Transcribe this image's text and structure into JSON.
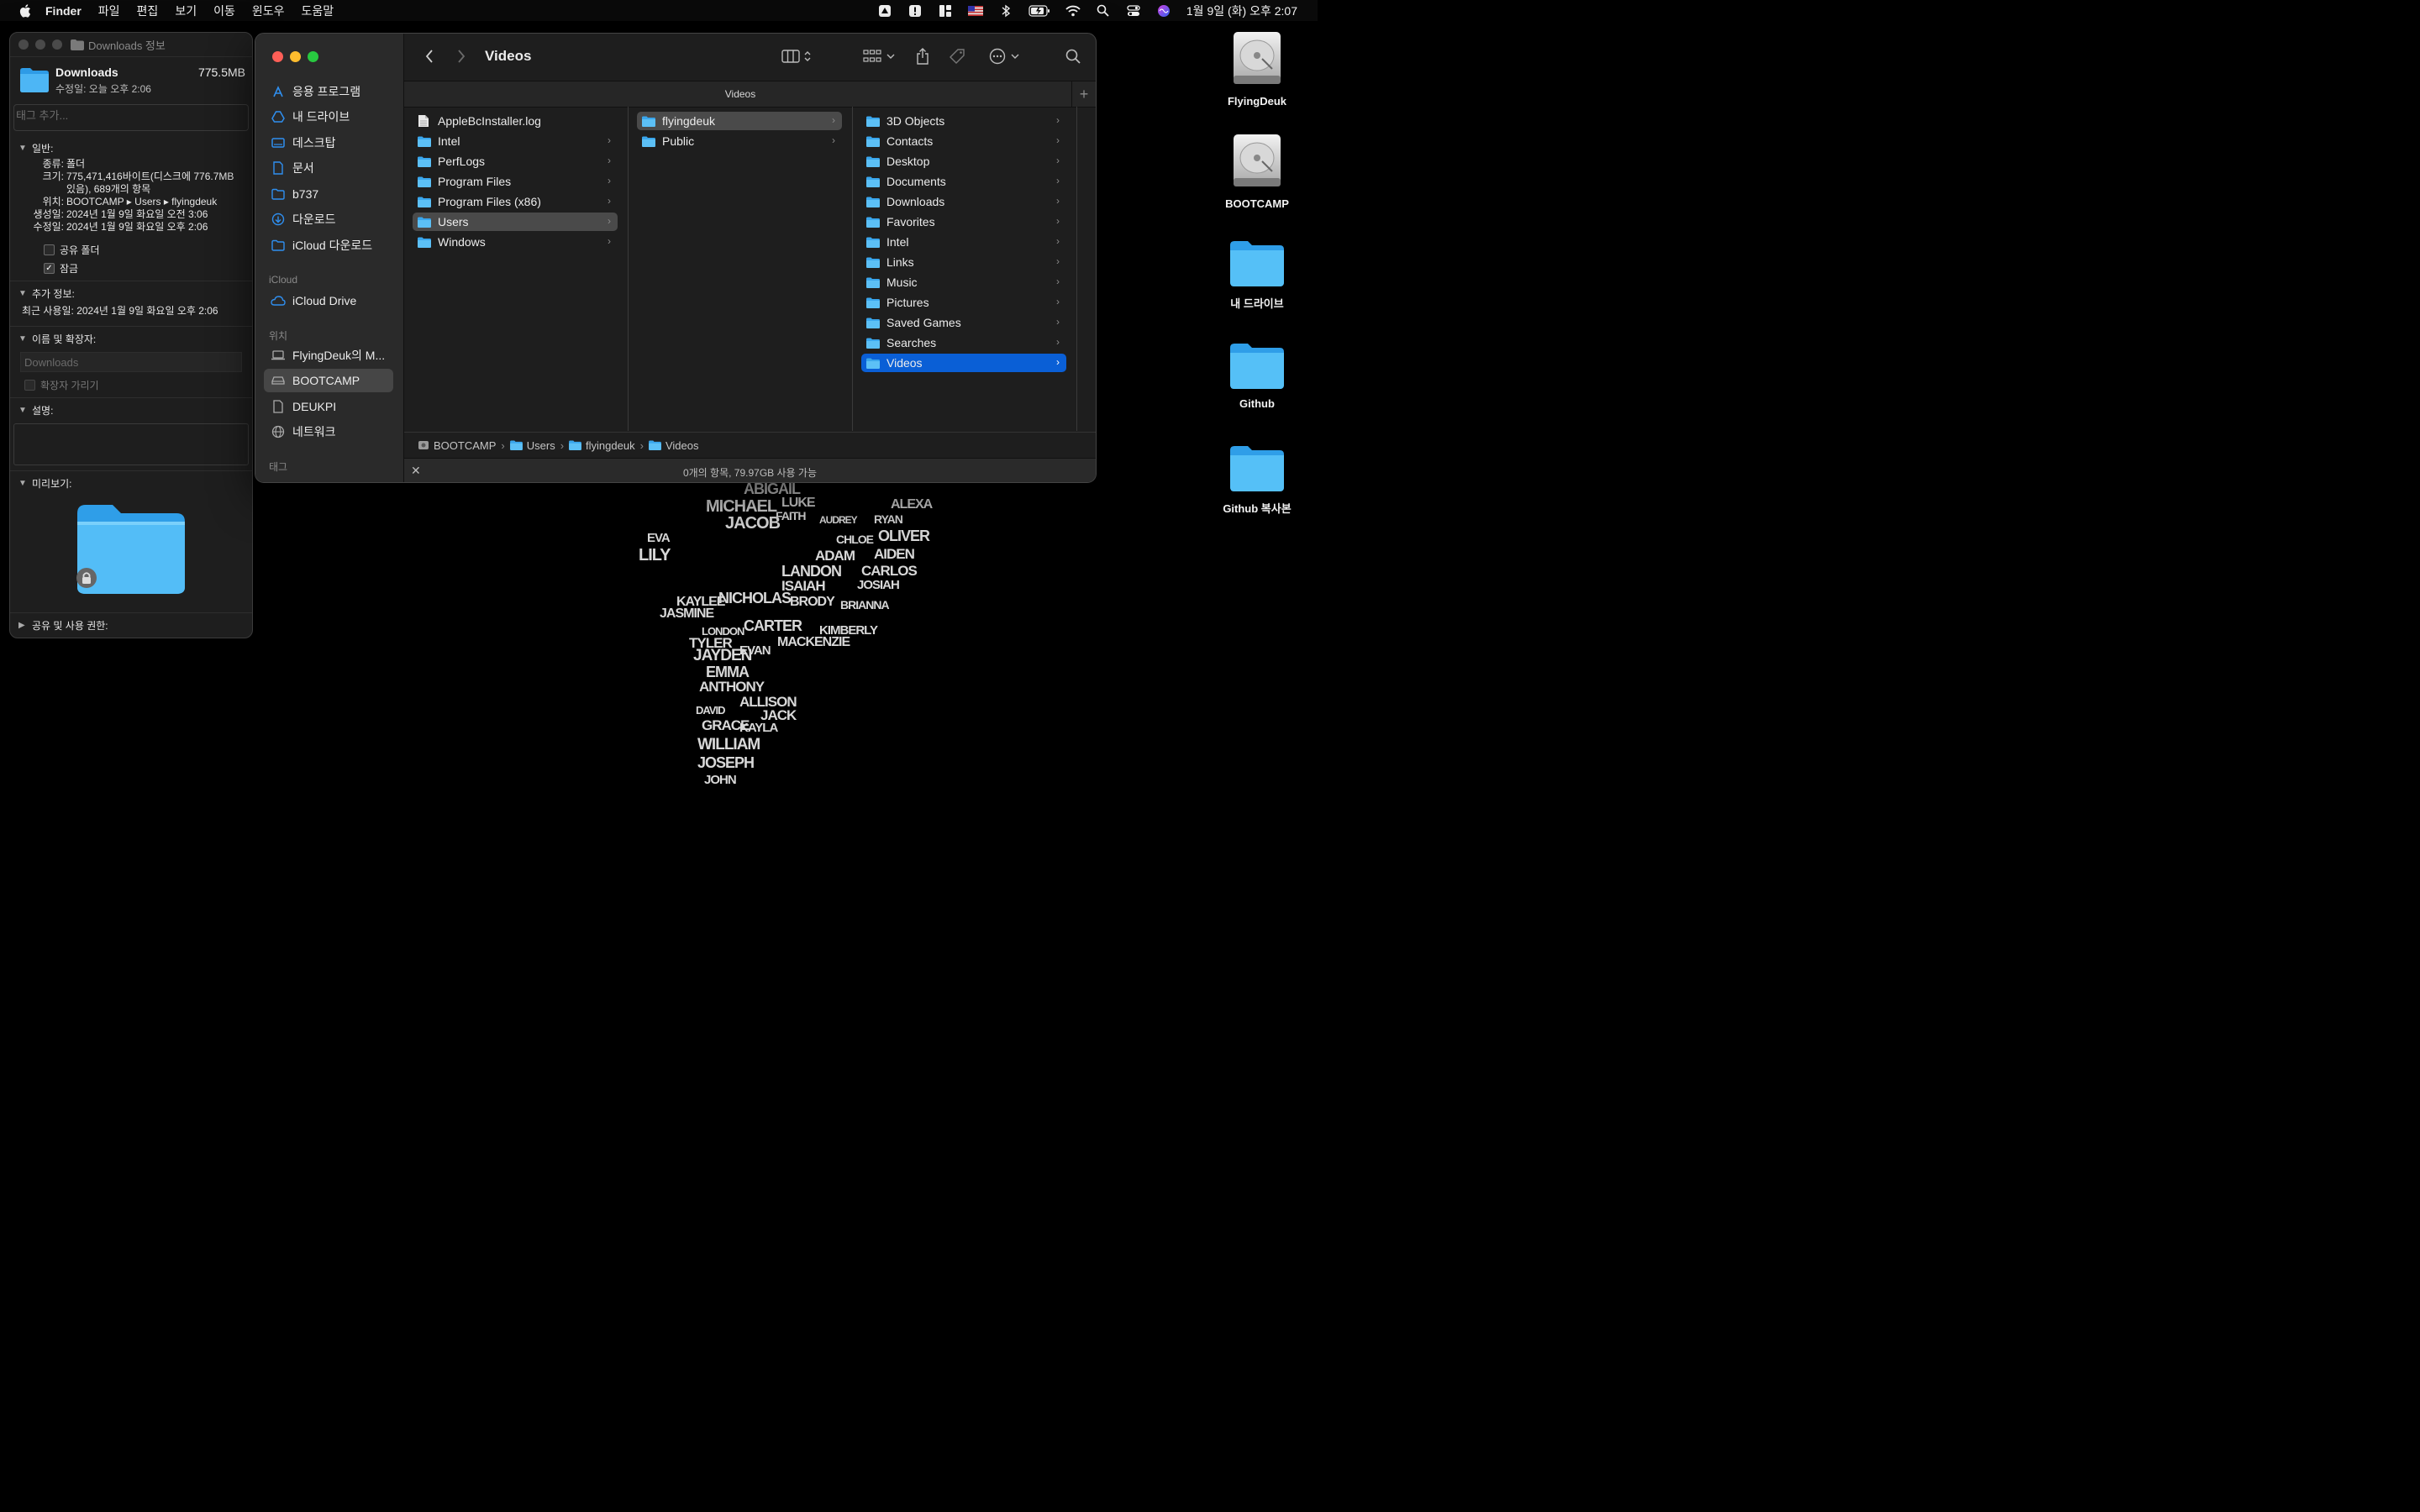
{
  "menubar": {
    "app": "Finder",
    "items": [
      "파일",
      "편집",
      "보기",
      "이동",
      "윈도우",
      "도움말"
    ],
    "clock": "1월 9일 (화) 오후 2:07",
    "status_icons": [
      "drive-icon",
      "alert-icon",
      "grid-app-icon",
      "us-flag-icon",
      "bluetooth-icon",
      "battery-icon",
      "wifi-icon",
      "search-icon",
      "control-center-icon",
      "siri-icon"
    ]
  },
  "info_window": {
    "title": "Downloads 정보",
    "name": "Downloads",
    "size": "775.5MB",
    "modified": "수정일: 오늘 오후 2:06",
    "tag_placeholder": "태그 추가...",
    "general_label": "일반:",
    "general": {
      "kind_k": "종류:",
      "kind_v": "폴더",
      "size_k": "크기:",
      "size_v1": "775,471,416바이트(디스크에 776.7MB",
      "size_v2": "있음), 689개의 항목",
      "where_k": "위치:",
      "where_v": "BOOTCAMP ▸ Users ▸ flyingdeuk",
      "created_k": "생성일:",
      "created_v": "2024년 1월 9일 화요일 오전 3:06",
      "modified_k": "수정일:",
      "modified_v": "2024년 1월 9일 화요일 오후 2:06"
    },
    "shared_folder": "공유 폴더",
    "locked": "잠금",
    "more_info_label": "추가 정보:",
    "last_used": "최근 사용일: 2024년 1월 9일 화요일 오후 2:06",
    "name_ext_label": "이름 및 확장자:",
    "name_value": "Downloads",
    "hide_ext": "확장자 가리기",
    "comments_label": "설명:",
    "preview_label": "미리보기:",
    "sharing_label": "공유 및 사용 권한:"
  },
  "finder": {
    "title": "Videos",
    "path_header": "Videos",
    "sidebar": {
      "favorites": [
        {
          "label": "응용 프로그램",
          "icon": "applications-icon"
        },
        {
          "label": "내 드라이브",
          "icon": "google-drive-icon"
        },
        {
          "label": "데스크탑",
          "icon": "desktop-icon"
        },
        {
          "label": "문서",
          "icon": "document-icon"
        },
        {
          "label": "b737",
          "icon": "folder-icon"
        },
        {
          "label": "다운로드",
          "icon": "download-icon"
        },
        {
          "label": "iCloud 다운로드",
          "icon": "folder-icon"
        }
      ],
      "icloud_header": "iCloud",
      "icloud": [
        {
          "label": "iCloud Drive",
          "icon": "cloud-icon"
        }
      ],
      "locations_header": "위치",
      "locations": [
        {
          "label": "FlyingDeuk의 M...",
          "icon": "laptop-icon"
        },
        {
          "label": "BOOTCAMP",
          "icon": "disk-icon"
        },
        {
          "label": "DEUKPI",
          "icon": "document-icon"
        },
        {
          "label": "네트워크",
          "icon": "globe-icon"
        }
      ],
      "tags_header": "태그"
    },
    "col1": [
      {
        "label": "AppleBcInstaller.log",
        "type": "file"
      },
      {
        "label": "Intel",
        "type": "folder"
      },
      {
        "label": "PerfLogs",
        "type": "folder"
      },
      {
        "label": "Program Files",
        "type": "folder"
      },
      {
        "label": "Program Files (x86)",
        "type": "folder"
      },
      {
        "label": "Users",
        "type": "folder"
      },
      {
        "label": "Windows",
        "type": "folder"
      }
    ],
    "col2": [
      {
        "label": "flyingdeuk",
        "type": "folder"
      },
      {
        "label": "Public",
        "type": "folder"
      }
    ],
    "col3": [
      {
        "label": "3D Objects"
      },
      {
        "label": "Contacts"
      },
      {
        "label": "Desktop"
      },
      {
        "label": "Documents"
      },
      {
        "label": "Downloads"
      },
      {
        "label": "Favorites"
      },
      {
        "label": "Intel"
      },
      {
        "label": "Links"
      },
      {
        "label": "Music"
      },
      {
        "label": "Pictures"
      },
      {
        "label": "Saved Games"
      },
      {
        "label": "Searches"
      },
      {
        "label": "Videos"
      }
    ],
    "pathbar": [
      "BOOTCAMP",
      "Users",
      "flyingdeuk",
      "Videos"
    ],
    "status": "0개의 항목, 79.97GB 사용 가능"
  },
  "desktop": [
    {
      "label": "FlyingDeuk",
      "icon": "hard-disk-icon"
    },
    {
      "label": "BOOTCAMP",
      "icon": "hard-disk-icon"
    },
    {
      "label": "내 드라이브",
      "icon": "folder-icon"
    },
    {
      "label": "Github",
      "icon": "folder-icon"
    },
    {
      "label": "Github 복사본",
      "icon": "folder-icon"
    }
  ],
  "wallpaper_words": [
    "ABIGAIL",
    "MICHAEL",
    "LUKE",
    "JACOB",
    "FAITH",
    "AUDREY",
    "ALEXA",
    "OLIVER",
    "EVA",
    "LILY",
    "AIDEN",
    "ADAM",
    "CARLOS",
    "LANDON",
    "ISAIAH",
    "JOSIAH",
    "KAYLEE",
    "NICHOLAS",
    "BRODY",
    "BRIANNA",
    "JASMINE",
    "CARTER",
    "KIMBERLY",
    "JAYDEN",
    "MACKENZIE",
    "EMMA",
    "ANTHONY",
    "ALLISON",
    "GRACE",
    "KAYLA",
    "JACK",
    "WILLIAM",
    "JOSEPH",
    "JOHN",
    "DAVID",
    "EVAN",
    "LONDON",
    "CHLOE",
    "TYLER",
    "RYAN"
  ]
}
